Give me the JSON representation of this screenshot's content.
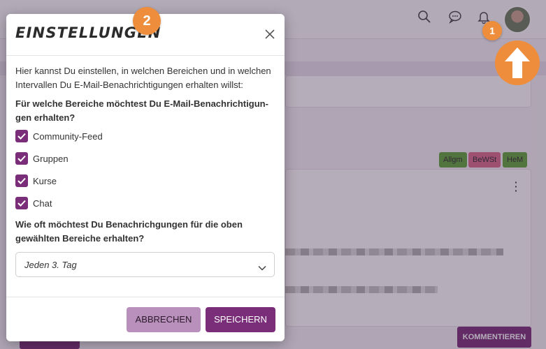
{
  "background": {
    "tags": [
      {
        "label": "Allgm",
        "color": "#5fa33a"
      },
      {
        "label": "BeWSt",
        "color": "#d86a8a"
      },
      {
        "label": "HeM",
        "color": "#5fa33a"
      }
    ],
    "comment_button": "KOMMENTIEREN"
  },
  "markers": {
    "one": "1",
    "two": "2"
  },
  "modal": {
    "title": "EINSTELLUNGEN",
    "intro": "Hier kannst Du einstellen, in welchen Bereichen und in welchen Intervallen Du E-Mail-Benachrichtigungen erhalten willst:",
    "question_areas": "Für welche Bereiche möchtest Du E-Mail-Benachrichtigun­gen erhalten?",
    "checkboxes": [
      {
        "label": "Community-Feed",
        "checked": true
      },
      {
        "label": "Gruppen",
        "checked": true
      },
      {
        "label": "Kurse",
        "checked": true
      },
      {
        "label": "Chat",
        "checked": true
      }
    ],
    "question_interval": "Wie oft möchtest Du Benachrichgungen für die oben gewähl­ten Bereiche erhalten?",
    "interval_select": {
      "value": "Jeden 3. Tag"
    },
    "buttons": {
      "cancel": "ABBRECHEN",
      "save": "SPEICHERN"
    }
  },
  "colors": {
    "accent": "#7a2e7a",
    "accent_light": "#b98fbc",
    "annotation": "#ee8e3c"
  }
}
